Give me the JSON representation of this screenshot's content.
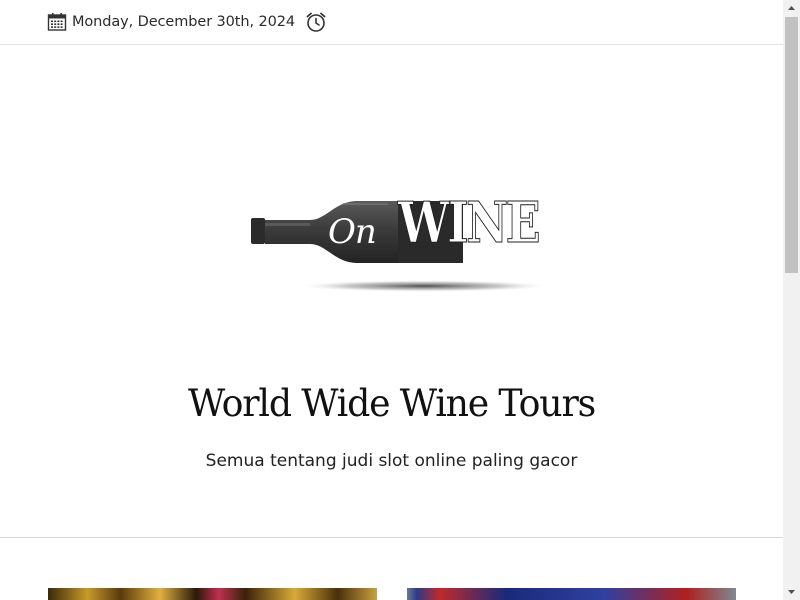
{
  "topbar": {
    "date": "Monday, December 30th, 2024",
    "calendar_icon": "calendar-icon",
    "alarm_icon": "alarm-clock-icon"
  },
  "logo": {
    "script_text": "On",
    "word_text": "WINE"
  },
  "site": {
    "title": "World Wide Wine Tours",
    "tagline": "Semua tentang judi slot online paling gacor"
  },
  "scrollbar": {
    "up_icon": "scroll-up-arrow-icon",
    "down_icon": "scroll-down-arrow-icon"
  }
}
